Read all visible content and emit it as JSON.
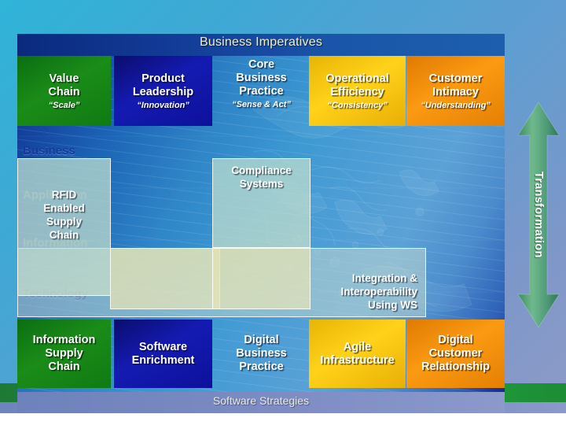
{
  "slide": {
    "header_title": "Business Imperatives",
    "footer_title": "Software Strategies"
  },
  "imperatives": [
    {
      "title": "Value\nChain",
      "title_l1": "Value",
      "title_l2": "Chain",
      "title_l3": "",
      "subtitle": "“Scale”",
      "color": "#0f7a13",
      "style": "green"
    },
    {
      "title": "Product\nLeadership",
      "title_l1": "Product",
      "title_l2": "Leadership",
      "title_l3": "",
      "subtitle": "“Innovation”",
      "color": "#0d109a",
      "style": "navy"
    },
    {
      "title": "Core\nBusiness\nPractice",
      "title_l1": "Core",
      "title_l2": "Business",
      "title_l3": "Practice",
      "subtitle": "“Sense & Act”",
      "color": "transparent",
      "style": "clear"
    },
    {
      "title": "Operational\nEfficiency",
      "title_l1": "Operational",
      "title_l2": "Efficiency",
      "title_l3": "",
      "subtitle": "“Consistency”",
      "color": "#e9ae04",
      "style": "gold"
    },
    {
      "title": "Customer\nIntimacy",
      "title_l1": "Customer",
      "title_l2": "Intimacy",
      "title_l3": "",
      "subtitle": "“Understanding”",
      "color": "#e57f03",
      "style": "orange"
    }
  ],
  "stack_labels": [
    {
      "label": "Business",
      "dimmed": false
    },
    {
      "label": "Application",
      "dimmed": true
    },
    {
      "label": "Information",
      "dimmed": true
    },
    {
      "label": "Technology",
      "dimmed": false
    }
  ],
  "middle_boxes": [
    {
      "label_l1": "RFID",
      "label_l2": "Enabled",
      "label_l3": "Supply",
      "label_l4": "Chain",
      "tint": "green"
    },
    {
      "label_l1": "Compliance",
      "label_l2": "Systems",
      "label_l3": "",
      "label_l4": "",
      "tint": "green"
    },
    {
      "label_l1": "Integration &",
      "label_l2": "Interoperability",
      "label_l3": "Using WS",
      "label_l4": "",
      "tint": "wide"
    }
  ],
  "strategies": [
    {
      "title_l1": "Information",
      "title_l2": "Supply",
      "title_l3": "Chain",
      "style": "green"
    },
    {
      "title_l1": "Software",
      "title_l2": "Enrichment",
      "title_l3": "",
      "style": "navy"
    },
    {
      "title_l1": "Digital",
      "title_l2": "Business",
      "title_l3": "Practice",
      "style": "clear"
    },
    {
      "title_l1": "Agile",
      "title_l2": "Infrastructure",
      "title_l3": "",
      "style": "gold"
    },
    {
      "title_l1": "Digital",
      "title_l2": "Customer",
      "title_l3": "Relationship",
      "style": "orange"
    }
  ],
  "arrow": {
    "label": "Transformation",
    "color_top": "#5fa77a",
    "color_bottom": "#4f9c86"
  },
  "colors": {
    "green": "#0f7a13",
    "navy": "#0d109a",
    "gold": "#e9ae04",
    "orange": "#e57f03",
    "header_text": "#f4f0c0",
    "stack_label": "#123a9e"
  }
}
